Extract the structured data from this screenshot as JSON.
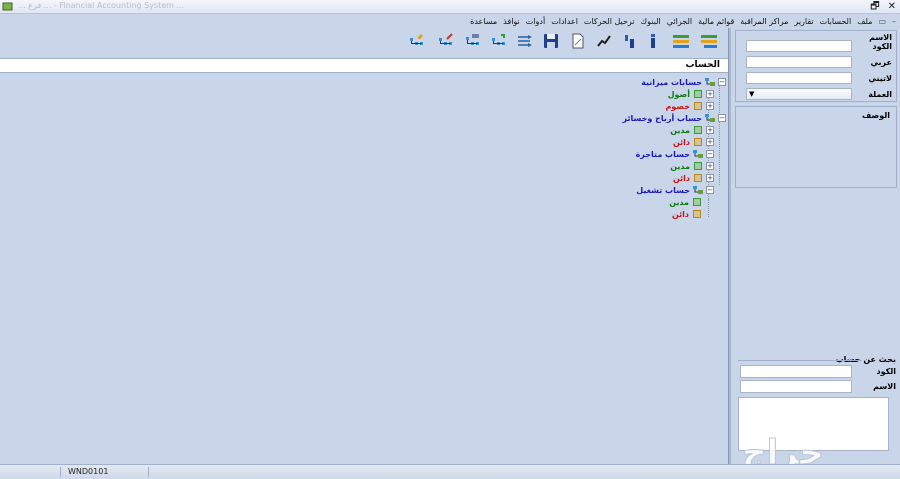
{
  "window": {
    "title": "... فرع ... - Financial Accounting System ..."
  },
  "menu": [
    "ملف",
    "الحسابات",
    "تقارير",
    "مراكز المراقبة",
    "قوائم مالية",
    "الجرائي",
    "البنوك",
    "ترحيل الحركات",
    "اعدادات",
    "أدوات",
    "نوافذ",
    "مساعدة"
  ],
  "tree": {
    "header": "الحساب",
    "nodes": [
      {
        "label": "حسابات ميزانية",
        "color": "#1a1ab4"
      },
      {
        "label": "أصول",
        "color": "#0f7a0f"
      },
      {
        "label": "خصوم",
        "color": "#c81414"
      },
      {
        "label": "حساب أرباح وخسائر",
        "color": "#1a1ab4"
      },
      {
        "label": "مدين",
        "color": "#0f7a0f"
      },
      {
        "label": "دائن",
        "color": "#c81414"
      },
      {
        "label": "حساب متاجرة",
        "color": "#1a1ab4"
      },
      {
        "label": "مدين",
        "color": "#0f7a0f"
      },
      {
        "label": "دائن",
        "color": "#c81414"
      },
      {
        "label": "حساب تشغيل",
        "color": "#1a1ab4"
      },
      {
        "label": "مدين",
        "color": "#0f7a0f"
      },
      {
        "label": "دائن",
        "color": "#c81414"
      }
    ]
  },
  "form": {
    "name_label": "الاسم",
    "code_label": "الكود",
    "arabic_label": "عربي",
    "latin_label": "لاتيني",
    "currency_label": "العملة",
    "description_label": "الوصف"
  },
  "search": {
    "title": "بحث عن حساب",
    "code_label": "الكود",
    "name_label": "الاسم"
  },
  "status": {
    "code": "WND0101"
  },
  "watermark": {
    "text": "حراج"
  },
  "icons": [
    "new-account-icon",
    "edit-account-icon",
    "delete-account-icon",
    "search-account-icon",
    "tree-icon",
    "save-icon",
    "print-preview-icon",
    "chart-icon",
    "column-icon",
    "bar-icon",
    "expand-icon",
    "collapse-icon"
  ]
}
